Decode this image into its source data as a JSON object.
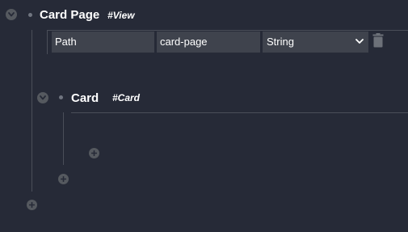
{
  "view": {
    "name": "Card Page",
    "tag": "#View",
    "param_row": {
      "key": "Path",
      "value": "card-page",
      "type": "String"
    }
  },
  "card": {
    "name": "Card",
    "tag": "#Card"
  },
  "icons": {
    "collapse": "chevron-down-icon",
    "add": "plus-icon",
    "delete": "trash-icon",
    "select": "chevron-down-icon"
  }
}
